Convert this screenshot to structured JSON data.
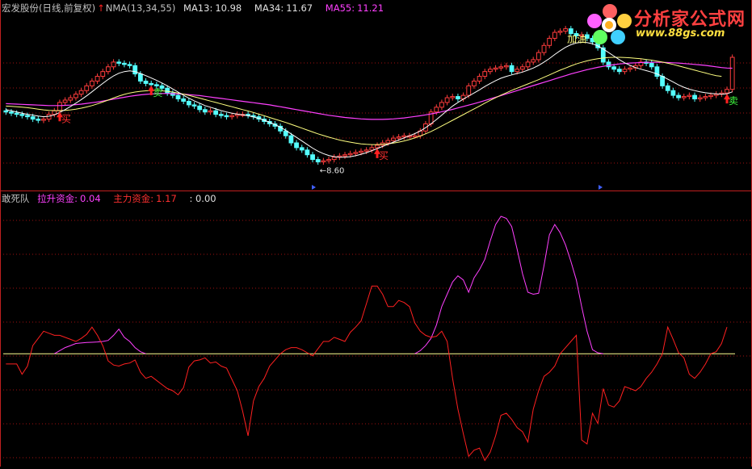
{
  "header_top": {
    "title": "宏发股份(日线,前复权)",
    "indicator": "NMA(13,34,55)",
    "ma13_label": "MA13:",
    "ma13_value": "10.98",
    "ma34_label": "MA34:",
    "ma34_value": "11.67",
    "ma55_label": "MA55:",
    "ma55_value": "11.21"
  },
  "header_bottom": {
    "title": "敢死队",
    "lift_label": "拉升资金:",
    "lift_value": "0.04",
    "main_label": "主力资金:",
    "main_value": "1.17",
    "extra": ": 0.00"
  },
  "logo": {
    "brand": "分析家公式网",
    "url": "www.88gs.com"
  },
  "colors": {
    "background": "#000000",
    "up": "#ff3c3c",
    "down": "#54ffff",
    "ma13": "#ffffff",
    "ma34": "#ffff80",
    "ma55": "#ff40ff",
    "lift": "#ff40ff",
    "main": "#ff2020",
    "zero": "#ffff90",
    "grid": "#a01010",
    "buy_arrow": "#ff2020"
  },
  "chart_data": [
    {
      "type": "candlestick",
      "title": "宏发股份(日线,前复权)",
      "annotations": [
        {
          "text": "买",
          "index": 10
        },
        {
          "text": "卖",
          "index": 27
        },
        {
          "text": "买",
          "index": 69
        },
        {
          "text": "加油",
          "index": 104
        },
        {
          "text": "卖",
          "index": 134
        }
      ],
      "low_label": "8.60",
      "ohlc_open": [
        11.45,
        11.4,
        11.35,
        11.3,
        11.25,
        11.2,
        11.1,
        11.05,
        11.1,
        11.3,
        11.45,
        11.8,
        11.9,
        12.0,
        12.15,
        12.3,
        12.5,
        12.7,
        12.9,
        13.1,
        13.3,
        13.5,
        13.45,
        13.4,
        13.35,
        13.0,
        12.7,
        12.6,
        12.55,
        12.5,
        12.4,
        12.2,
        12.1,
        11.95,
        11.85,
        11.7,
        11.65,
        11.5,
        11.4,
        11.45,
        11.3,
        11.25,
        11.2,
        11.25,
        11.3,
        11.3,
        11.25,
        11.2,
        11.1,
        11.0,
        10.9,
        10.8,
        10.6,
        10.4,
        10.1,
        9.9,
        9.8,
        9.6,
        9.4,
        9.3,
        9.35,
        9.4,
        9.5,
        9.55,
        9.6,
        9.65,
        9.7,
        9.75,
        9.8,
        9.9,
        10.0,
        10.1,
        10.2,
        10.3,
        10.35,
        10.4,
        10.4,
        10.4,
        10.6,
        10.9,
        11.4,
        11.6,
        11.8,
        12.0,
        12.05,
        11.95,
        12.1,
        12.5,
        12.7,
        12.9,
        13.1,
        13.2,
        13.25,
        13.3,
        13.35,
        13.1,
        13.2,
        13.3,
        13.5,
        13.6,
        13.9,
        14.2,
        14.5,
        14.75,
        14.8,
        14.9,
        14.7,
        14.6,
        14.65,
        14.5,
        14.35,
        14.1,
        13.5,
        13.3,
        13.2,
        13.1,
        13.2,
        13.25,
        13.35,
        13.5,
        13.45,
        13.3,
        12.9,
        12.5,
        12.3,
        12.1,
        12.0,
        12.05,
        12.1,
        11.95,
        12.0,
        12.05,
        12.1,
        12.15,
        12.2,
        12.35
      ],
      "ohlc_close": [
        11.4,
        11.35,
        11.3,
        11.25,
        11.2,
        11.1,
        11.05,
        11.1,
        11.3,
        11.45,
        11.8,
        11.9,
        12.0,
        12.15,
        12.3,
        12.5,
        12.7,
        12.9,
        13.1,
        13.3,
        13.5,
        13.45,
        13.4,
        13.35,
        13.0,
        12.7,
        12.6,
        12.55,
        12.5,
        12.4,
        12.2,
        12.1,
        11.95,
        11.85,
        11.7,
        11.65,
        11.5,
        11.4,
        11.45,
        11.3,
        11.25,
        11.2,
        11.25,
        11.3,
        11.3,
        11.25,
        11.2,
        11.1,
        11.0,
        10.9,
        10.8,
        10.6,
        10.4,
        10.1,
        9.9,
        9.8,
        9.6,
        9.4,
        9.3,
        9.35,
        9.4,
        9.5,
        9.55,
        9.6,
        9.65,
        9.7,
        9.75,
        9.8,
        9.9,
        10.0,
        10.1,
        10.2,
        10.3,
        10.35,
        10.4,
        10.4,
        10.4,
        10.6,
        10.9,
        11.4,
        11.6,
        11.8,
        12.0,
        12.05,
        11.95,
        12.1,
        12.5,
        12.7,
        12.9,
        13.1,
        13.2,
        13.25,
        13.3,
        13.35,
        13.1,
        13.2,
        13.3,
        13.5,
        13.6,
        13.9,
        14.2,
        14.5,
        14.75,
        14.8,
        14.9,
        14.7,
        14.6,
        14.65,
        14.5,
        14.35,
        14.1,
        13.5,
        13.3,
        13.2,
        13.1,
        13.2,
        13.25,
        13.35,
        13.5,
        13.45,
        13.3,
        12.9,
        12.5,
        12.3,
        12.1,
        12.0,
        12.05,
        12.1,
        11.95,
        12.0,
        12.05,
        12.1,
        12.15,
        12.2,
        12.35,
        13.7
      ],
      "ma13": [
        11.5,
        11.45,
        11.4,
        11.35,
        11.3,
        11.27,
        11.23,
        11.2,
        11.22,
        11.28,
        11.38,
        11.5,
        11.63,
        11.77,
        11.92,
        12.08,
        12.25,
        12.43,
        12.6,
        12.77,
        12.92,
        13.03,
        13.1,
        13.13,
        13.1,
        13.02,
        12.93,
        12.83,
        12.73,
        12.62,
        12.5,
        12.37,
        12.24,
        12.1,
        11.98,
        11.87,
        11.77,
        11.67,
        11.6,
        11.53,
        11.46,
        11.4,
        11.35,
        11.31,
        11.28,
        11.24,
        11.19,
        11.13,
        11.05,
        10.97,
        10.87,
        10.76,
        10.63,
        10.48,
        10.33,
        10.18,
        10.03,
        9.88,
        9.75,
        9.65,
        9.57,
        9.52,
        9.5,
        9.5,
        9.52,
        9.56,
        9.62,
        9.69,
        9.77,
        9.86,
        9.95,
        10.04,
        10.13,
        10.22,
        10.31,
        10.4,
        10.49,
        10.6,
        10.74,
        10.9,
        11.08,
        11.27,
        11.46,
        11.65,
        11.8,
        11.94,
        12.07,
        12.2,
        12.33,
        12.47,
        12.6,
        12.72,
        12.82,
        12.9,
        12.96,
        13.02,
        13.08,
        13.16,
        13.25,
        13.36,
        13.5,
        13.65,
        13.82,
        13.98,
        14.12,
        14.23,
        14.3,
        14.33,
        14.32,
        14.27,
        14.18,
        14.05,
        13.9,
        13.75,
        13.6,
        13.47,
        13.36,
        13.27,
        13.2,
        13.14,
        13.08,
        13.0,
        12.9,
        12.78,
        12.66,
        12.54,
        12.44,
        12.36,
        12.3,
        12.25,
        12.21,
        12.18,
        12.16,
        12.15,
        12.16,
        12.25
      ],
      "ma34": [
        11.65,
        11.64,
        11.62,
        11.6,
        11.58,
        11.55,
        11.52,
        11.49,
        11.47,
        11.46,
        11.46,
        11.47,
        11.49,
        11.52,
        11.56,
        11.61,
        11.67,
        11.74,
        11.82,
        11.9,
        11.99,
        12.07,
        12.14,
        12.2,
        12.24,
        12.27,
        12.29,
        12.3,
        12.3,
        12.29,
        12.27,
        12.24,
        12.2,
        12.15,
        12.1,
        12.04,
        11.98,
        11.92,
        11.86,
        11.8,
        11.74,
        11.68,
        11.62,
        11.56,
        11.5,
        11.44,
        11.38,
        11.31,
        11.24,
        11.17,
        11.1,
        11.03,
        10.96,
        10.88,
        10.8,
        10.72,
        10.64,
        10.56,
        10.48,
        10.41,
        10.34,
        10.28,
        10.22,
        10.17,
        10.13,
        10.09,
        10.06,
        10.04,
        10.03,
        10.03,
        10.04,
        10.06,
        10.09,
        10.13,
        10.18,
        10.24,
        10.31,
        10.39,
        10.48,
        10.58,
        10.69,
        10.81,
        10.93,
        11.05,
        11.17,
        11.29,
        11.41,
        11.53,
        11.65,
        11.77,
        11.89,
        12.0,
        12.11,
        12.21,
        12.31,
        12.4,
        12.49,
        12.58,
        12.67,
        12.76,
        12.86,
        12.96,
        13.06,
        13.16,
        13.25,
        13.34,
        13.42,
        13.49,
        13.55,
        13.6,
        13.64,
        13.67,
        13.69,
        13.7,
        13.7,
        13.69,
        13.68,
        13.66,
        13.64,
        13.61,
        13.58,
        13.54,
        13.5,
        13.45,
        13.4,
        13.34,
        13.28,
        13.22,
        13.16,
        13.1,
        13.04,
        12.98,
        12.93,
        12.9
      ],
      "ma55": [
        11.75,
        11.74,
        11.73,
        11.72,
        11.71,
        11.7,
        11.69,
        11.68,
        11.67,
        11.67,
        11.67,
        11.68,
        11.69,
        11.71,
        11.73,
        11.76,
        11.79,
        11.82,
        11.86,
        11.9,
        11.94,
        11.98,
        12.02,
        12.06,
        12.09,
        12.12,
        12.14,
        12.16,
        12.17,
        12.18,
        12.18,
        12.17,
        12.16,
        12.15,
        12.13,
        12.11,
        12.09,
        12.06,
        12.03,
        12.0,
        11.97,
        11.94,
        11.91,
        11.88,
        11.85,
        11.82,
        11.79,
        11.76,
        11.73,
        11.7,
        11.66,
        11.62,
        11.58,
        11.54,
        11.5,
        11.46,
        11.42,
        11.38,
        11.34,
        11.3,
        11.26,
        11.23,
        11.2,
        11.17,
        11.15,
        11.13,
        11.11,
        11.1,
        11.09,
        11.09,
        11.09,
        11.1,
        11.11,
        11.13,
        11.15,
        11.18,
        11.21,
        11.24,
        11.28,
        11.32,
        11.36,
        11.41,
        11.46,
        11.51,
        11.57,
        11.63,
        11.69,
        11.75,
        11.81,
        11.88,
        11.95,
        12.02,
        12.09,
        12.16,
        12.23,
        12.3,
        12.37,
        12.44,
        12.51,
        12.58,
        12.65,
        12.72,
        12.79,
        12.86,
        12.93,
        13.0,
        13.06,
        13.12,
        13.18,
        13.23,
        13.28,
        13.32,
        13.36,
        13.39,
        13.42,
        13.44,
        13.46,
        13.47,
        13.48,
        13.49,
        13.49,
        13.49,
        13.49,
        13.48,
        13.47,
        13.46,
        13.44,
        13.42,
        13.4,
        13.38,
        13.36,
        13.33,
        13.3,
        13.27,
        13.25,
        13.24
      ],
      "ylim": [
        8.3,
        15.5
      ]
    },
    {
      "type": "line",
      "title": "敢死队",
      "series": [
        {
          "name": "拉升资金",
          "values": [
            0,
            0,
            0,
            0,
            0,
            0,
            0,
            0,
            0,
            0,
            0.3,
            0.6,
            0.8,
            1.0,
            1.05,
            1.1,
            1.12,
            1.15,
            1.2,
            1.3,
            1.8,
            2.4,
            1.6,
            1.2,
            0.6,
            0.2,
            0,
            0,
            0,
            0,
            0,
            0,
            0,
            0,
            0,
            0,
            0,
            0,
            0,
            0,
            0,
            0,
            0,
            0,
            0,
            0,
            0,
            0,
            0,
            0,
            0,
            0,
            0,
            0,
            0,
            0,
            0,
            0,
            0,
            0,
            0,
            0,
            0,
            0,
            0,
            0,
            0,
            0,
            0,
            0,
            0,
            0,
            0,
            0,
            0,
            0,
            0,
            0.3,
            0.8,
            1.5,
            2.8,
            4.6,
            5.8,
            7.0,
            7.6,
            7.2,
            6.0,
            7.4,
            8.2,
            9.2,
            11.0,
            12.6,
            13.4,
            13.2,
            12.4,
            10.2,
            7.8,
            6.0,
            5.8,
            5.9,
            8.6,
            11.6,
            12.6,
            11.8,
            10.6,
            9.0,
            7.2,
            4.6,
            2.2,
            0.4,
            0.1,
            0,
            0,
            0,
            0,
            0,
            0,
            0,
            0,
            0,
            0,
            0,
            0,
            0,
            0,
            0,
            0,
            0,
            0,
            0,
            0,
            0,
            0,
            0,
            0
          ]
        },
        {
          "name": "主力资金",
          "values": [
            -1.0,
            -1.0,
            -1.0,
            -2.0,
            -1.2,
            0.8,
            1.5,
            2.2,
            2.0,
            1.8,
            1.8,
            1.6,
            1.4,
            1.2,
            1.5,
            1.9,
            2.6,
            1.8,
            0.8,
            -0.7,
            -1.1,
            -1.2,
            -1.0,
            -0.9,
            -0.6,
            -1.8,
            -2.4,
            -2.2,
            -2.6,
            -3.0,
            -3.4,
            -3.6,
            -4.0,
            -3.3,
            -1.3,
            -0.7,
            -0.6,
            -0.4,
            -0.9,
            -0.8,
            -1.2,
            -1.4,
            -2.5,
            -3.6,
            -5.6,
            -8.0,
            -4.6,
            -3.2,
            -2.4,
            -1.2,
            -0.6,
            0,
            0.4,
            0.6,
            0.6,
            0.4,
            0.1,
            -0.2,
            0.5,
            1.2,
            1.2,
            1.6,
            1.4,
            1.2,
            2.1,
            2.6,
            3.2,
            4.9,
            6.6,
            6.6,
            5.8,
            4.6,
            4.6,
            5.2,
            5.0,
            4.6,
            3.0,
            2.2,
            1.8,
            1.6,
            1.7,
            2.2,
            1.2,
            -2.4,
            -5.4,
            -7.8,
            -10.0,
            -9.4,
            -9.2,
            -10.4,
            -9.6,
            -8.0,
            -6.0,
            -5.8,
            -6.4,
            -7.2,
            -7.6,
            -8.6,
            -5.4,
            -3.6,
            -2.2,
            -1.8,
            -1.2,
            0,
            0.6,
            1.2,
            1.8,
            -8.4,
            -8.8,
            -5.8,
            -6.8,
            -3.4,
            -5.0,
            -5.2,
            -4.6,
            -3.2,
            -3.4,
            -3.6,
            -3.2,
            -2.4,
            -1.8,
            -1.0,
            0,
            2.6,
            1.4,
            0.1,
            -0.4,
            -2.0,
            -2.4,
            -1.8,
            -1.0,
            0,
            0.2,
            1.0,
            2.6
          ]
        }
      ],
      "zero_line": 0,
      "ylim": [
        -11,
        14.5
      ]
    }
  ]
}
